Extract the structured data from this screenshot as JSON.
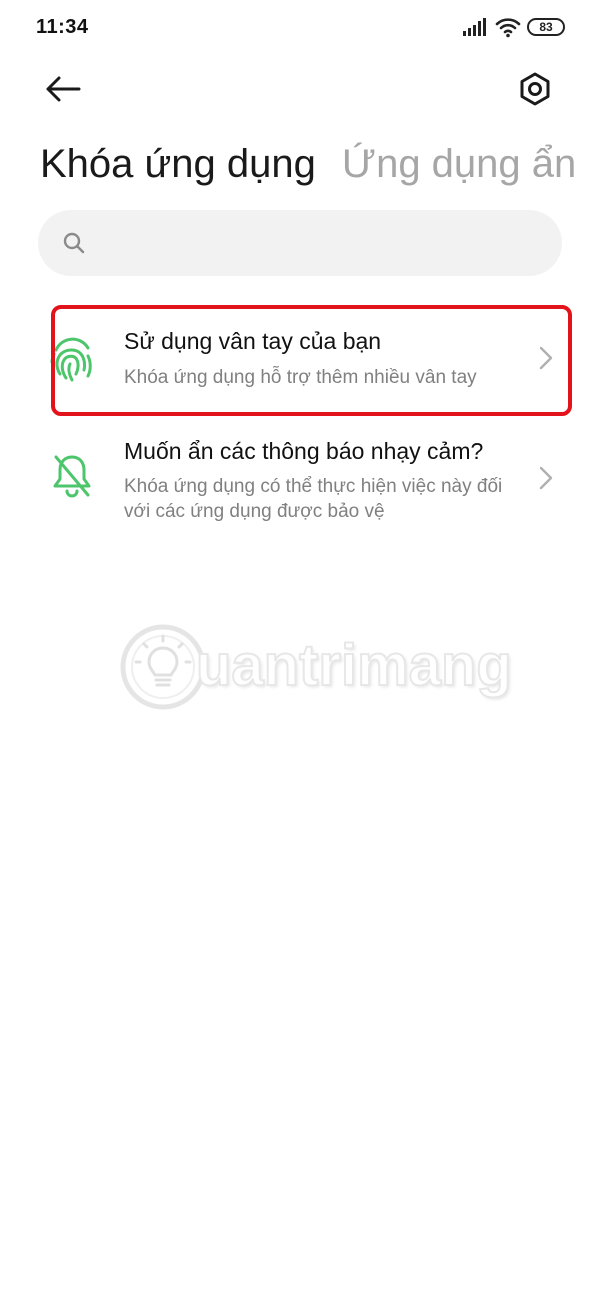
{
  "status_bar": {
    "time": "11:34",
    "battery": "83",
    "signal_icon": "signal-icon",
    "wifi_icon": "wifi-icon"
  },
  "nav": {
    "back_icon": "arrow-left-icon",
    "settings_icon": "gear-icon"
  },
  "tabs": [
    {
      "label": "Khóa ứng dụng",
      "active": true
    },
    {
      "label": "Ứng dụng ẩn",
      "active": false
    }
  ],
  "search": {
    "placeholder": "",
    "value": "",
    "icon": "search-icon"
  },
  "items": [
    {
      "title": "Sử dụng vân tay của bạn",
      "subtitle": "Khóa ứng dụng hỗ trợ thêm nhiều vân tay",
      "icon": "fingerprint-icon",
      "highlighted": true
    },
    {
      "title": "Muốn ẩn các thông báo nhạy cảm?",
      "subtitle": "Khóa ứng dụng có thể thực hiện việc này đối với các ứng dụng được bảo vệ",
      "icon": "bell-off-icon",
      "highlighted": false
    }
  ],
  "watermark": {
    "text": "uantrimang"
  },
  "colors": {
    "accent_green": "#4cc56b",
    "highlight_red": "#e3131b",
    "search_bg": "#f2f2f2",
    "inactive_tab": "#a6a6a6"
  }
}
